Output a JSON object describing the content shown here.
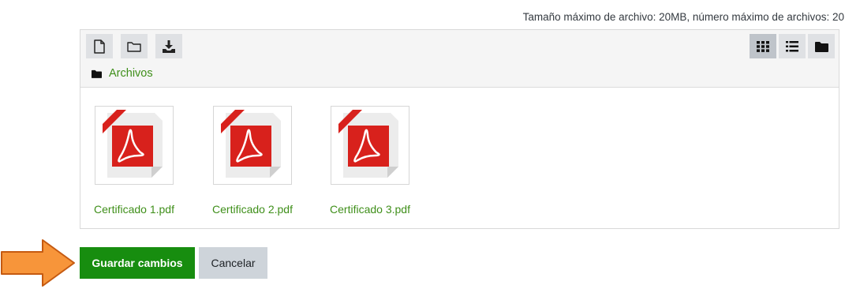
{
  "limits_text": "Tamaño máximo de archivo: 20MB, número máximo de archivos: 20",
  "toolbar": {
    "left_buttons": [
      {
        "name": "add-file-button",
        "icon": "file-icon"
      },
      {
        "name": "create-folder-button",
        "icon": "folder-outline-icon"
      },
      {
        "name": "download-button",
        "icon": "download-icon"
      }
    ],
    "right_buttons": [
      {
        "name": "view-icons-button",
        "icon": "grid-icon",
        "active": true
      },
      {
        "name": "view-details-button",
        "icon": "list-icon",
        "active": false
      },
      {
        "name": "view-tree-button",
        "icon": "folder-icon",
        "active": false
      }
    ]
  },
  "path": {
    "label": "Archivos",
    "icon": "folder-icon"
  },
  "files": [
    {
      "name": "Certificado 1.pdf",
      "icon": "pdf-icon"
    },
    {
      "name": "Certificado 2.pdf",
      "icon": "pdf-icon"
    },
    {
      "name": "Certificado 3.pdf",
      "icon": "pdf-icon"
    }
  ],
  "actions": {
    "save_label": "Guardar cambios",
    "cancel_label": "Cancelar"
  },
  "colors": {
    "accent": "#178d0f",
    "link": "#3f8f1a",
    "arrow": "#f7953a",
    "pdf_red": "#d8211c"
  }
}
